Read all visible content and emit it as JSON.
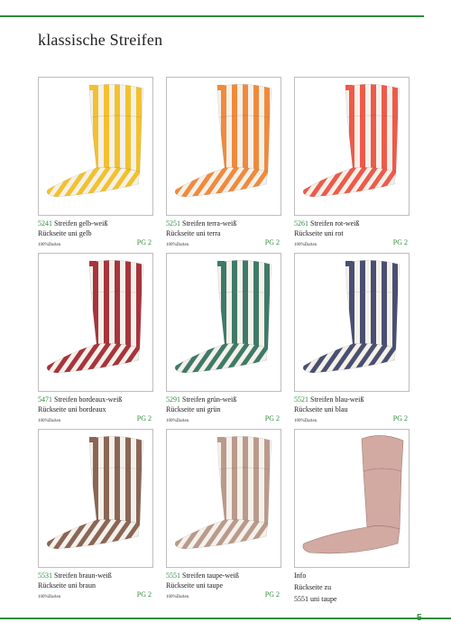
{
  "page": {
    "title": "klassische Streifen",
    "page_number": "5",
    "accent_color": "#2e8b3a"
  },
  "products": [
    {
      "code": "5241",
      "name": "Streifen gelb-weiß",
      "back": "Rückseite uni gelb",
      "fabric": "100%Darlen",
      "group": "PG 2",
      "stripe_color": "#f2c12e",
      "back_color": "#f2c12e"
    },
    {
      "code": "5251",
      "name": "Streifen terra-weiß",
      "back": "Rückseite uni terra",
      "fabric": "100%Darlen",
      "group": "PG 2",
      "stripe_color": "#f08a3c",
      "back_color": "#f08a3c"
    },
    {
      "code": "5261",
      "name": "Streifen rot-weiß",
      "back": "Rückseite uni rot",
      "fabric": "100%Darlen",
      "group": "PG 2",
      "stripe_color": "#ee5a4a",
      "back_color": "#ee5a4a"
    },
    {
      "code": "5471",
      "name": "Streifen bordeaux-weiß",
      "back": "Rückseite uni bordeaux",
      "fabric": "100%Darlen",
      "group": "PG 2",
      "stripe_color": "#a8343c",
      "back_color": "#a8343c"
    },
    {
      "code": "5291",
      "name": "Streifen grün-weiß",
      "back": "Rückseite uni grün",
      "fabric": "100%Darlen",
      "group": "PG 2",
      "stripe_color": "#3f7a68",
      "back_color": "#3f7a68"
    },
    {
      "code": "5521",
      "name": "Streifen blau-weiß",
      "back": "Rückseite uni blau",
      "fabric": "100%Darlen",
      "group": "PG 2",
      "stripe_color": "#4a4f72",
      "back_color": "#4a4f72"
    },
    {
      "code": "5531",
      "name": "Streifen braun-weiß",
      "back": "Rückseite uni braun",
      "fabric": "100%Darlen",
      "group": "PG 2",
      "stripe_color": "#8a6656",
      "back_color": "#8a6656"
    },
    {
      "code": "5551",
      "name": "Streifen taupe-weiß",
      "back": "Rückseite uni taupe",
      "fabric": "100%Darlen",
      "group": "PG 2",
      "stripe_color": "#b99a8c",
      "back_color": "#b99a8c"
    }
  ],
  "info": {
    "label": "Info",
    "line1": "Rückseite zu",
    "line2": "5551 uni taupe",
    "back_color": "#d2aaa2"
  }
}
